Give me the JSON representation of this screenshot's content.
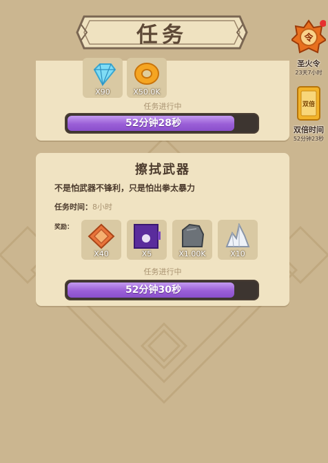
{
  "page": {
    "title": "任务"
  },
  "quests": [
    {
      "rewards": [
        {
          "icon": "diamond-icon",
          "count": "X90"
        },
        {
          "icon": "coin-icon",
          "count": "X50.0K"
        }
      ],
      "status": "任务进行中",
      "timer": "52分钟28秒",
      "progress": 0.98
    },
    {
      "title": "擦拭武器",
      "description": "不是怕武器不锋利，只是怕出拳太暴力",
      "time_label": "任务时间：",
      "time_value": "8小时",
      "rewards_label": "奖励：",
      "rewards": [
        {
          "icon": "badge-icon",
          "count": "X40"
        },
        {
          "icon": "purple-tile-icon",
          "count": "X5"
        },
        {
          "icon": "stone-icon",
          "count": "X1.00K"
        },
        {
          "icon": "crystal-icon",
          "count": "X10"
        }
      ],
      "status": "任务进行中",
      "timer": "52分钟30秒",
      "progress": 0.98
    }
  ],
  "side": {
    "token": {
      "name": "圣火令",
      "timer": "23天7小时",
      "glyph": "令"
    },
    "double": {
      "name": "双倍时间",
      "timer": "52分钟23秒",
      "glyph": "双倍"
    }
  },
  "colors": {
    "bar_fill": "#9a5fd7",
    "bar_track": "#3d3530",
    "card": "#f0e3c2",
    "background": "#cbb690"
  }
}
